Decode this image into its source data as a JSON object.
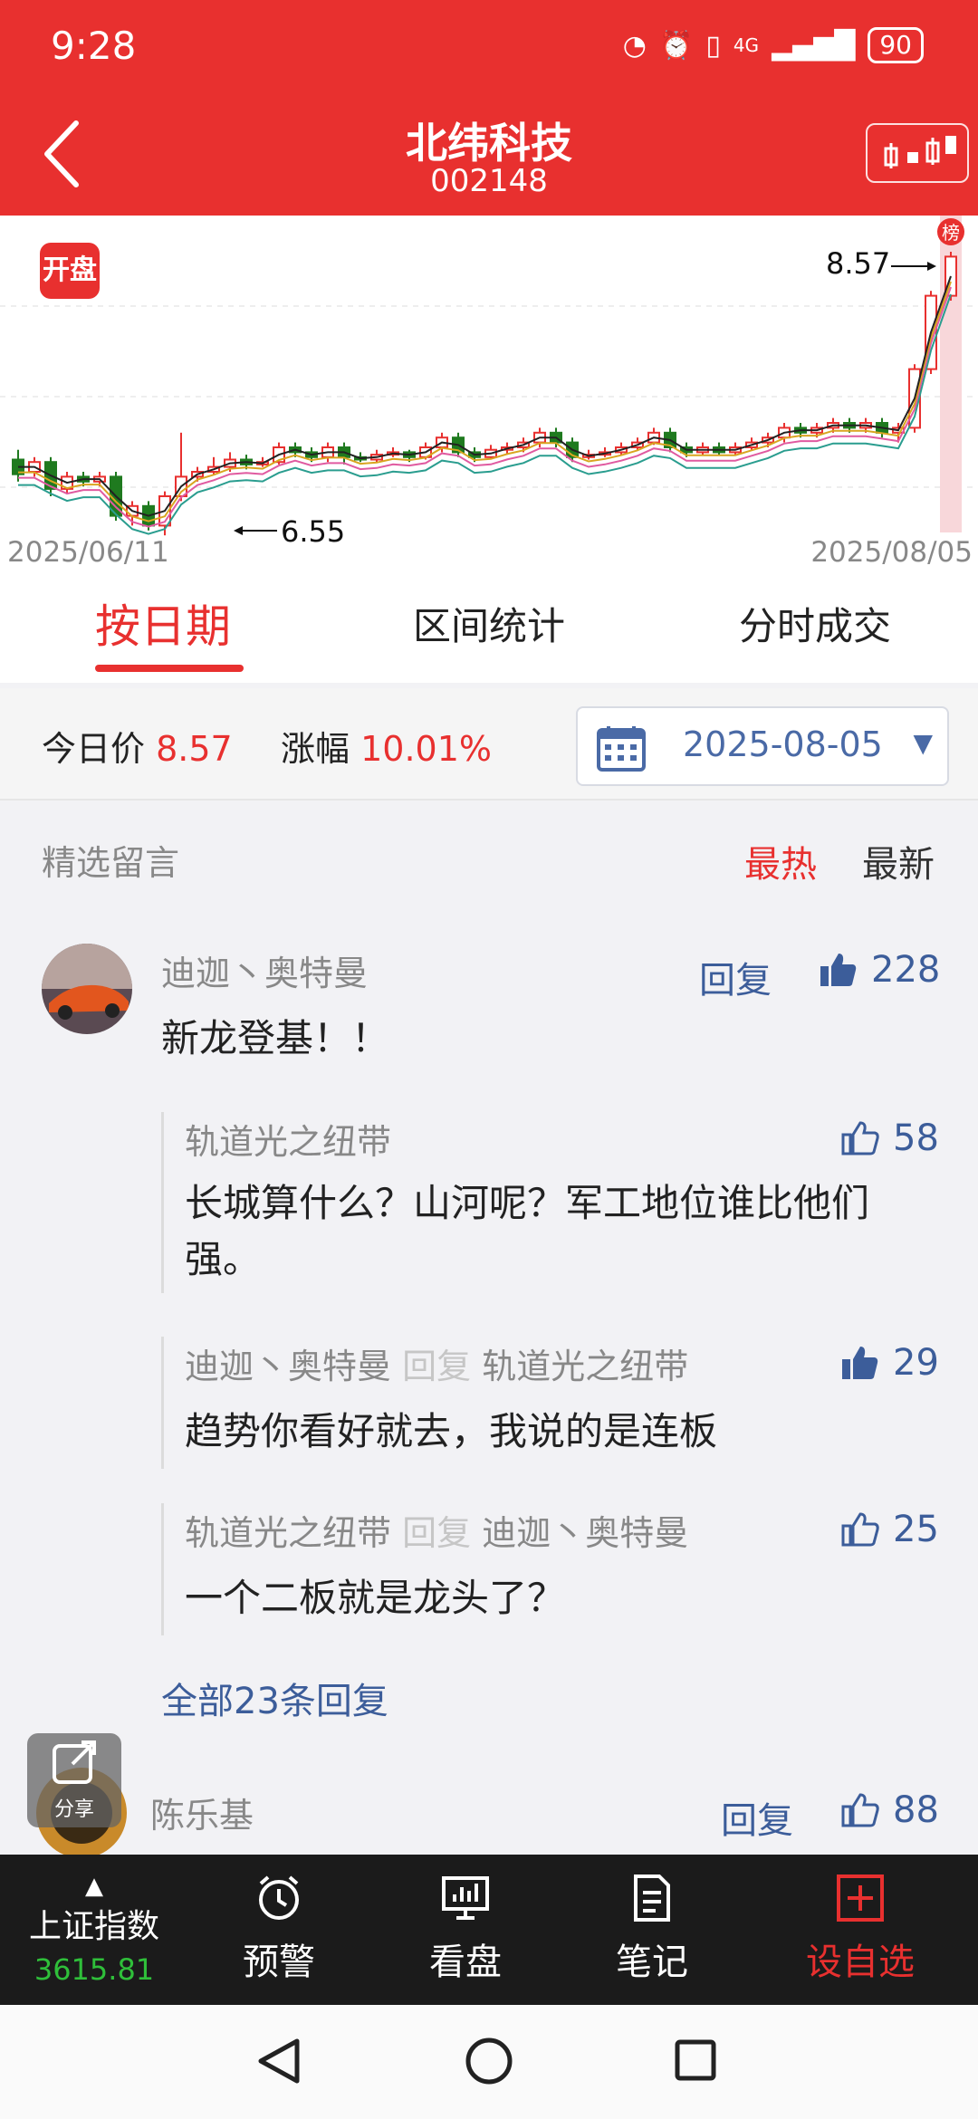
{
  "status": {
    "time": "9:28",
    "battery": "90",
    "network": "4G"
  },
  "header": {
    "title": "北纬科技",
    "code": "002148"
  },
  "chart": {
    "badge": "开盘",
    "date_start": "2025/06/11",
    "date_end": "2025/08/05",
    "high_label": "8.57",
    "low_label": "6.55",
    "marker_text": "榜"
  },
  "chart_data": {
    "type": "candlestick",
    "x_range": [
      "2025/06/11",
      "2025/08/05"
    ],
    "annotations": [
      {
        "label": "8.57",
        "type": "high"
      },
      {
        "label": "6.55",
        "type": "low"
      }
    ],
    "colors": {
      "up": "#e8302f",
      "down": "#1f7a1f",
      "ma5": "#222222",
      "ma10": "#d9a520",
      "ma20": "#e05aa0",
      "ma60": "#2a9d8f"
    }
  },
  "tabs": [
    {
      "label": "按日期",
      "active": true
    },
    {
      "label": "区间统计",
      "active": false
    },
    {
      "label": "分时成交",
      "active": false
    }
  ],
  "pricebar": {
    "price_label": "今日价",
    "price_value": "8.57",
    "change_label": "涨幅",
    "change_value": "10.01%",
    "date": "2025-08-05"
  },
  "comments": {
    "section_title": "精选留言",
    "sort_hot": "最热",
    "sort_new": "最新",
    "main": {
      "user": "迪迦丶奥特曼",
      "text": "新龙登基！！",
      "reply_label": "回复",
      "likes": "228"
    },
    "replies": [
      {
        "user": "轨道光之纽带",
        "to": "",
        "text": "长城算什么？山河呢？军工地位谁比他们强。",
        "likes": "58"
      },
      {
        "user": "迪迦丶奥特曼",
        "reply_word": "回复",
        "to": "轨道光之纽带",
        "text": "趋势你看好就去，我说的是连板",
        "likes": "29"
      },
      {
        "user": "轨道光之纽带",
        "reply_word": "回复",
        "to": "迪迦丶奥特曼",
        "text": "一个二板就是龙头了？",
        "likes": "25"
      }
    ],
    "all_replies": "全部23条回复",
    "second": {
      "user": "陈乐基",
      "reply_label": "回复",
      "likes": "88"
    }
  },
  "share": {
    "label": "分享"
  },
  "toolbar": {
    "index_name": "上证指数",
    "index_value": "3615.81",
    "alert": "预警",
    "watch": "看盘",
    "notes": "笔记",
    "add": "设自选"
  },
  "colors": {
    "brand_red": "#e8302f",
    "link_blue": "#3c5d9a",
    "index_green": "#2fbf3a"
  }
}
